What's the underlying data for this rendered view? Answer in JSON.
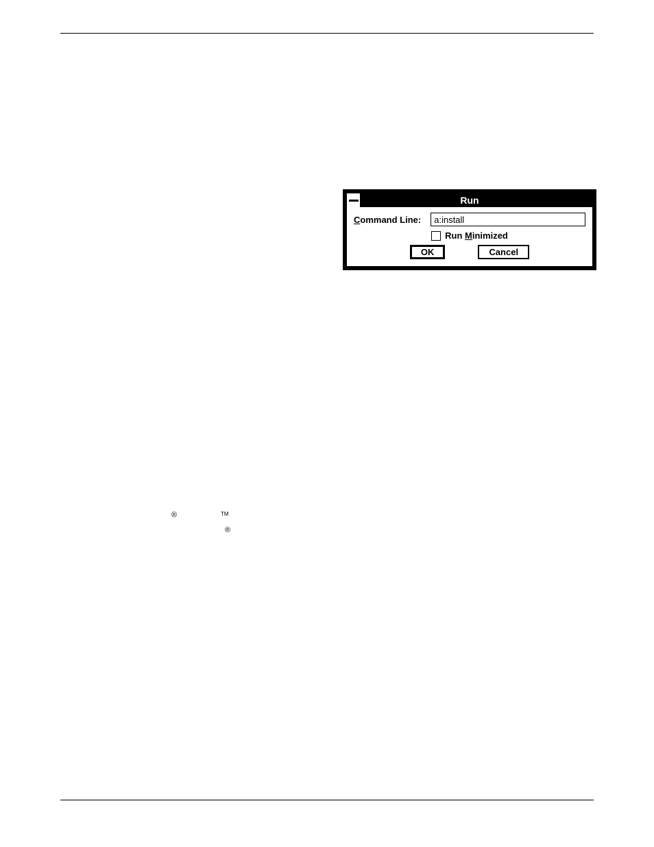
{
  "dialog": {
    "title": "Run",
    "command_line_label_pre": "C",
    "command_line_label_post": "ommand Line:",
    "command_line_value": "a:install",
    "run_minimized_pre": "Run ",
    "run_minimized_underline": "M",
    "run_minimized_post": "inimized",
    "ok_label": "OK",
    "cancel_label": "Cancel"
  },
  "marks": {
    "registered": "®",
    "trademark": "TM"
  }
}
